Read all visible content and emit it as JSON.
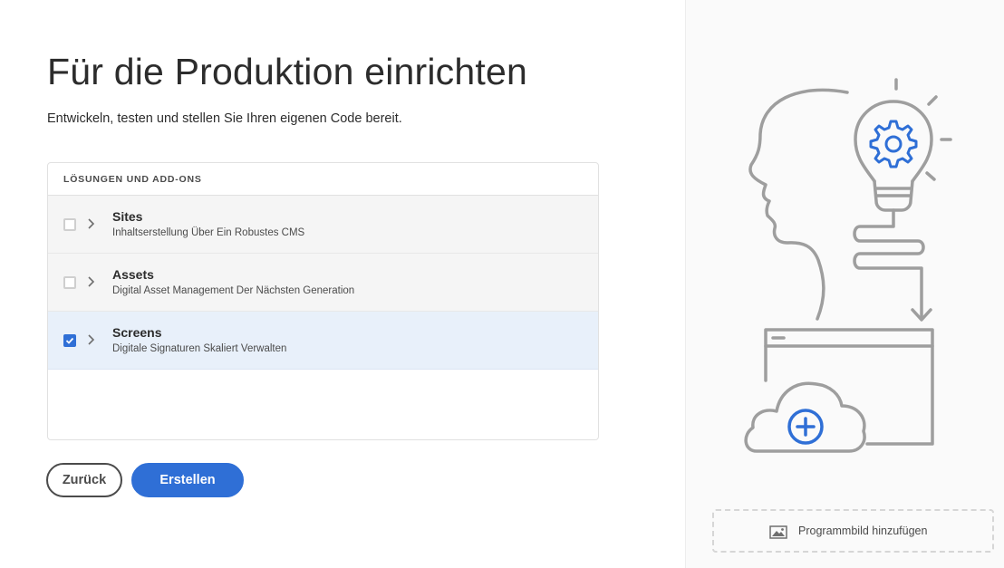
{
  "page": {
    "title": "Für die Produktion einrichten",
    "subtitle": "Entwickeln, testen und stellen Sie Ihren eigenen Code bereit."
  },
  "solutions": {
    "header": "LÖSUNGEN UND ADD-ONS",
    "items": [
      {
        "title": "Sites",
        "description": "Inhaltserstellung Über Ein Robustes CMS",
        "checked": false
      },
      {
        "title": "Assets",
        "description": "Digital Asset Management Der Nächsten Generation",
        "checked": false
      },
      {
        "title": "Screens",
        "description": "Digitale Signaturen Skaliert Verwalten",
        "checked": true
      }
    ]
  },
  "actions": {
    "back_label": "Zurück",
    "create_label": "Erstellen"
  },
  "sidebar": {
    "add_image_label": "Programmbild hinzufügen"
  },
  "colors": {
    "accent": "#2f6fd6",
    "illustration_stroke": "#9e9e9e",
    "selected_row": "#e8f0fa"
  }
}
